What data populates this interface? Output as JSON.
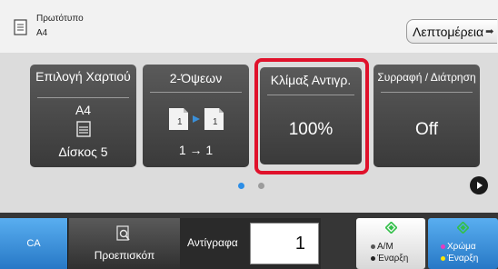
{
  "header": {
    "original_label": "Πρωτότυπο",
    "original_size": "A4",
    "details_button": "Λεπτομέρεια",
    "doc_icon": "document-icon",
    "details_arrow_icon": "arrow-right-icon"
  },
  "tiles": {
    "paper": {
      "title": "Επιλογή Χαρτιού",
      "size": "A4",
      "tray": "Δίσκος 5",
      "icon": "paper-tray-icon"
    },
    "duplex": {
      "title": "2-Όψεων",
      "mode": "1 → 1",
      "icon": "duplex-pages-icon"
    },
    "scale": {
      "title": "Κλίμαξ Αντιγρ.",
      "value": "100%"
    },
    "sort": {
      "title": "Συρραφή / Διάτρηση",
      "value": "Off"
    }
  },
  "pagination": {
    "current_page": 1,
    "total_pages": 2
  },
  "bottom": {
    "ca": "CA",
    "preview": "Προεπισκόπ",
    "preview_icon": "magnifier-document-icon",
    "copies_label": "Αντίγραφα",
    "copies_value": "1",
    "bw_start_line1": "A/M",
    "bw_start_line2": "Έναρξη",
    "color_start_line1": "Χρώμα",
    "color_start_line2": "Έναρξη",
    "start_icon": "diamond-start-icon"
  },
  "colors": {
    "accent_blue": "#2778c6",
    "highlight_red": "#e0112b",
    "start_green": "#33c04a"
  }
}
